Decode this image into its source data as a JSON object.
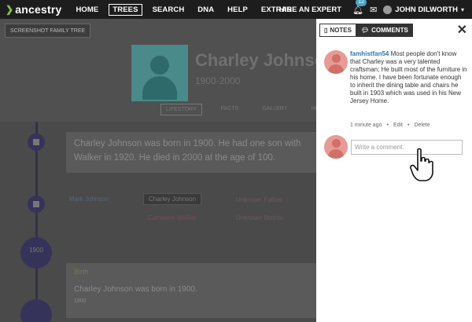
{
  "topnav": {
    "logo_text": "ancestry",
    "items": [
      "HOME",
      "TREES",
      "SEARCH",
      "DNA",
      "HELP",
      "EXTRAS"
    ],
    "active_index": 1,
    "hire_label": "HIRE AN EXPERT",
    "notification_count": "12",
    "user_name": "JOHN DILWORTH"
  },
  "profile": {
    "tree_selector": "SCREENSHOT FAMILY TREE",
    "name": "Charley Johnson",
    "years": "1900-2000",
    "tabs": [
      "LIFESTORY",
      "FACTS",
      "GALLERY",
      "HINTS"
    ]
  },
  "timeline": {
    "summary": "Charley Johnson was born in 1900. He had one son with Walker in 1920. He died in 2000 at the age of 100.",
    "family": {
      "father": "Mark Johnson",
      "main": "Charley Johnson",
      "mother": "Catherine Walker",
      "unknown_1": "Unknown Father",
      "unknown_2": "Unknown Mother"
    },
    "birth_year_badge": "1900",
    "birth_age_badge": "",
    "birth_label": "Birth",
    "birth_text": "Charley Johnson was born in 1900.",
    "birth_year": "1900"
  },
  "comments_panel": {
    "notes_label": "NOTES",
    "comments_label": "COMMENTS",
    "active_tab": "comments",
    "comment": {
      "author": "famhistfan54",
      "text": "Most people don't know that Charley was a very talented craftsman; He built most of the furniture in his home. I have been fortunate enough to inherit the dining table and chairs he built in 1903 which was used in his New Jersey Home.",
      "time": "1 minute ago",
      "actions": [
        "Edit",
        "Delete"
      ]
    },
    "input_placeholder": "Write a comment."
  },
  "colors": {
    "nav_bg": "#1d1d1d",
    "panel_bg": "#ffffff",
    "avatar_pink": "#e99a94",
    "link_blue": "#2a7aaa",
    "timeline_purple": "#36335a",
    "badge_blue": "#4aa4c9"
  }
}
